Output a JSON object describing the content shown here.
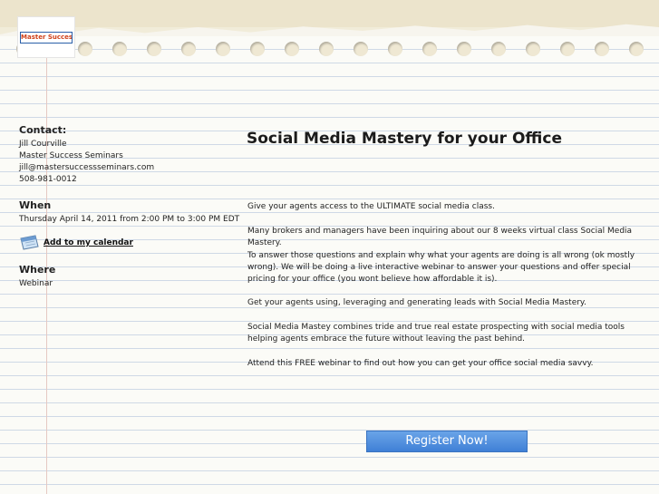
{
  "logo": {
    "text": "Master Success"
  },
  "contact": {
    "heading": "Contact:",
    "name": "Jill Courville",
    "company": "Master Success Seminars",
    "email": "jill@mastersuccessseminars.com",
    "phone": "508-981-0012"
  },
  "when": {
    "heading": "When",
    "datetime": "Thursday April 14, 2011 from 2:00 PM to 3:00 PM EDT",
    "calendar_link": "Add to my calendar"
  },
  "where": {
    "heading": "Where",
    "location": "Webinar"
  },
  "main": {
    "title": "Social Media Mastery for your Office",
    "paragraphs": [
      "Give your agents access to the ULTIMATE social media class.",
      "Many brokers and managers have been inquiring about our 8 weeks virtual class Social Media Mastery.",
      "To answer those questions and explain why what your agents are doing is all wrong (ok mostly wrong).  We will be doing a live interactive webinar to answer your questions and offer special pricing for your office (you wont believe how affordable it is).",
      "Get your agents using, leveraging and generating leads with Social Media Mastery.",
      "Social Media Mastey combines tride and true real estate prospecting with social media tools helping agents embrace the future without leaving the past behind.",
      "Attend this FREE webinar to find out how you can get your office social media savvy."
    ],
    "register_label": "Register Now!"
  },
  "icons": {
    "calendar": "calendar-icon"
  }
}
